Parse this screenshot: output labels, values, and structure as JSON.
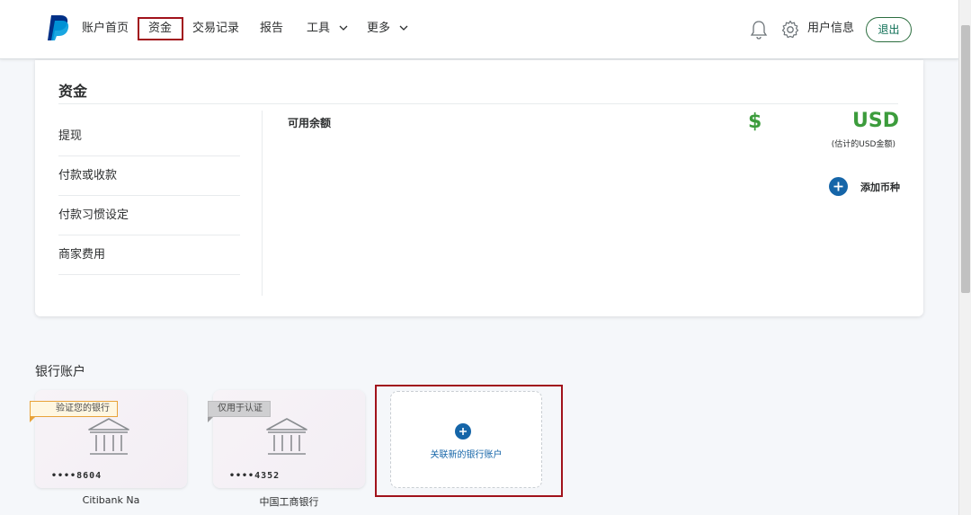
{
  "nav": {
    "items": [
      {
        "label": "账户首页"
      },
      {
        "label": "资金"
      },
      {
        "label": "交易记录"
      },
      {
        "label": "报告"
      },
      {
        "label": "工具"
      },
      {
        "label": "更多"
      }
    ],
    "user_label": "用户信息",
    "logout_label": "退出",
    "icons": {
      "logo": "paypal-logo",
      "notifications": "bell-icon",
      "settings": "gear-icon",
      "dropdown": "chevron-down-icon"
    }
  },
  "funds": {
    "title": "资金",
    "menu": [
      {
        "label": "提现"
      },
      {
        "label": "付款或收款"
      },
      {
        "label": "付款习惯设定"
      },
      {
        "label": "商家费用"
      }
    ],
    "balance_label": "可用余额",
    "currency_symbol": "$",
    "currency_code": "USD",
    "estimate_note": "(估计的USD金额)",
    "add_currency_label": "添加币种"
  },
  "bank": {
    "title": "银行账户",
    "cards": [
      {
        "badge": "验证您的银行",
        "digits": "••••8604",
        "name": "Citibank Na"
      },
      {
        "badge": "仅用于认证",
        "digits": "••••4352",
        "name": "中国工商银行"
      }
    ],
    "add_label": "关联新的银行账户"
  },
  "colors": {
    "accent_green": "#3c9c3c",
    "paypal_blue": "#1565a8",
    "highlight_red": "#a1121b"
  }
}
